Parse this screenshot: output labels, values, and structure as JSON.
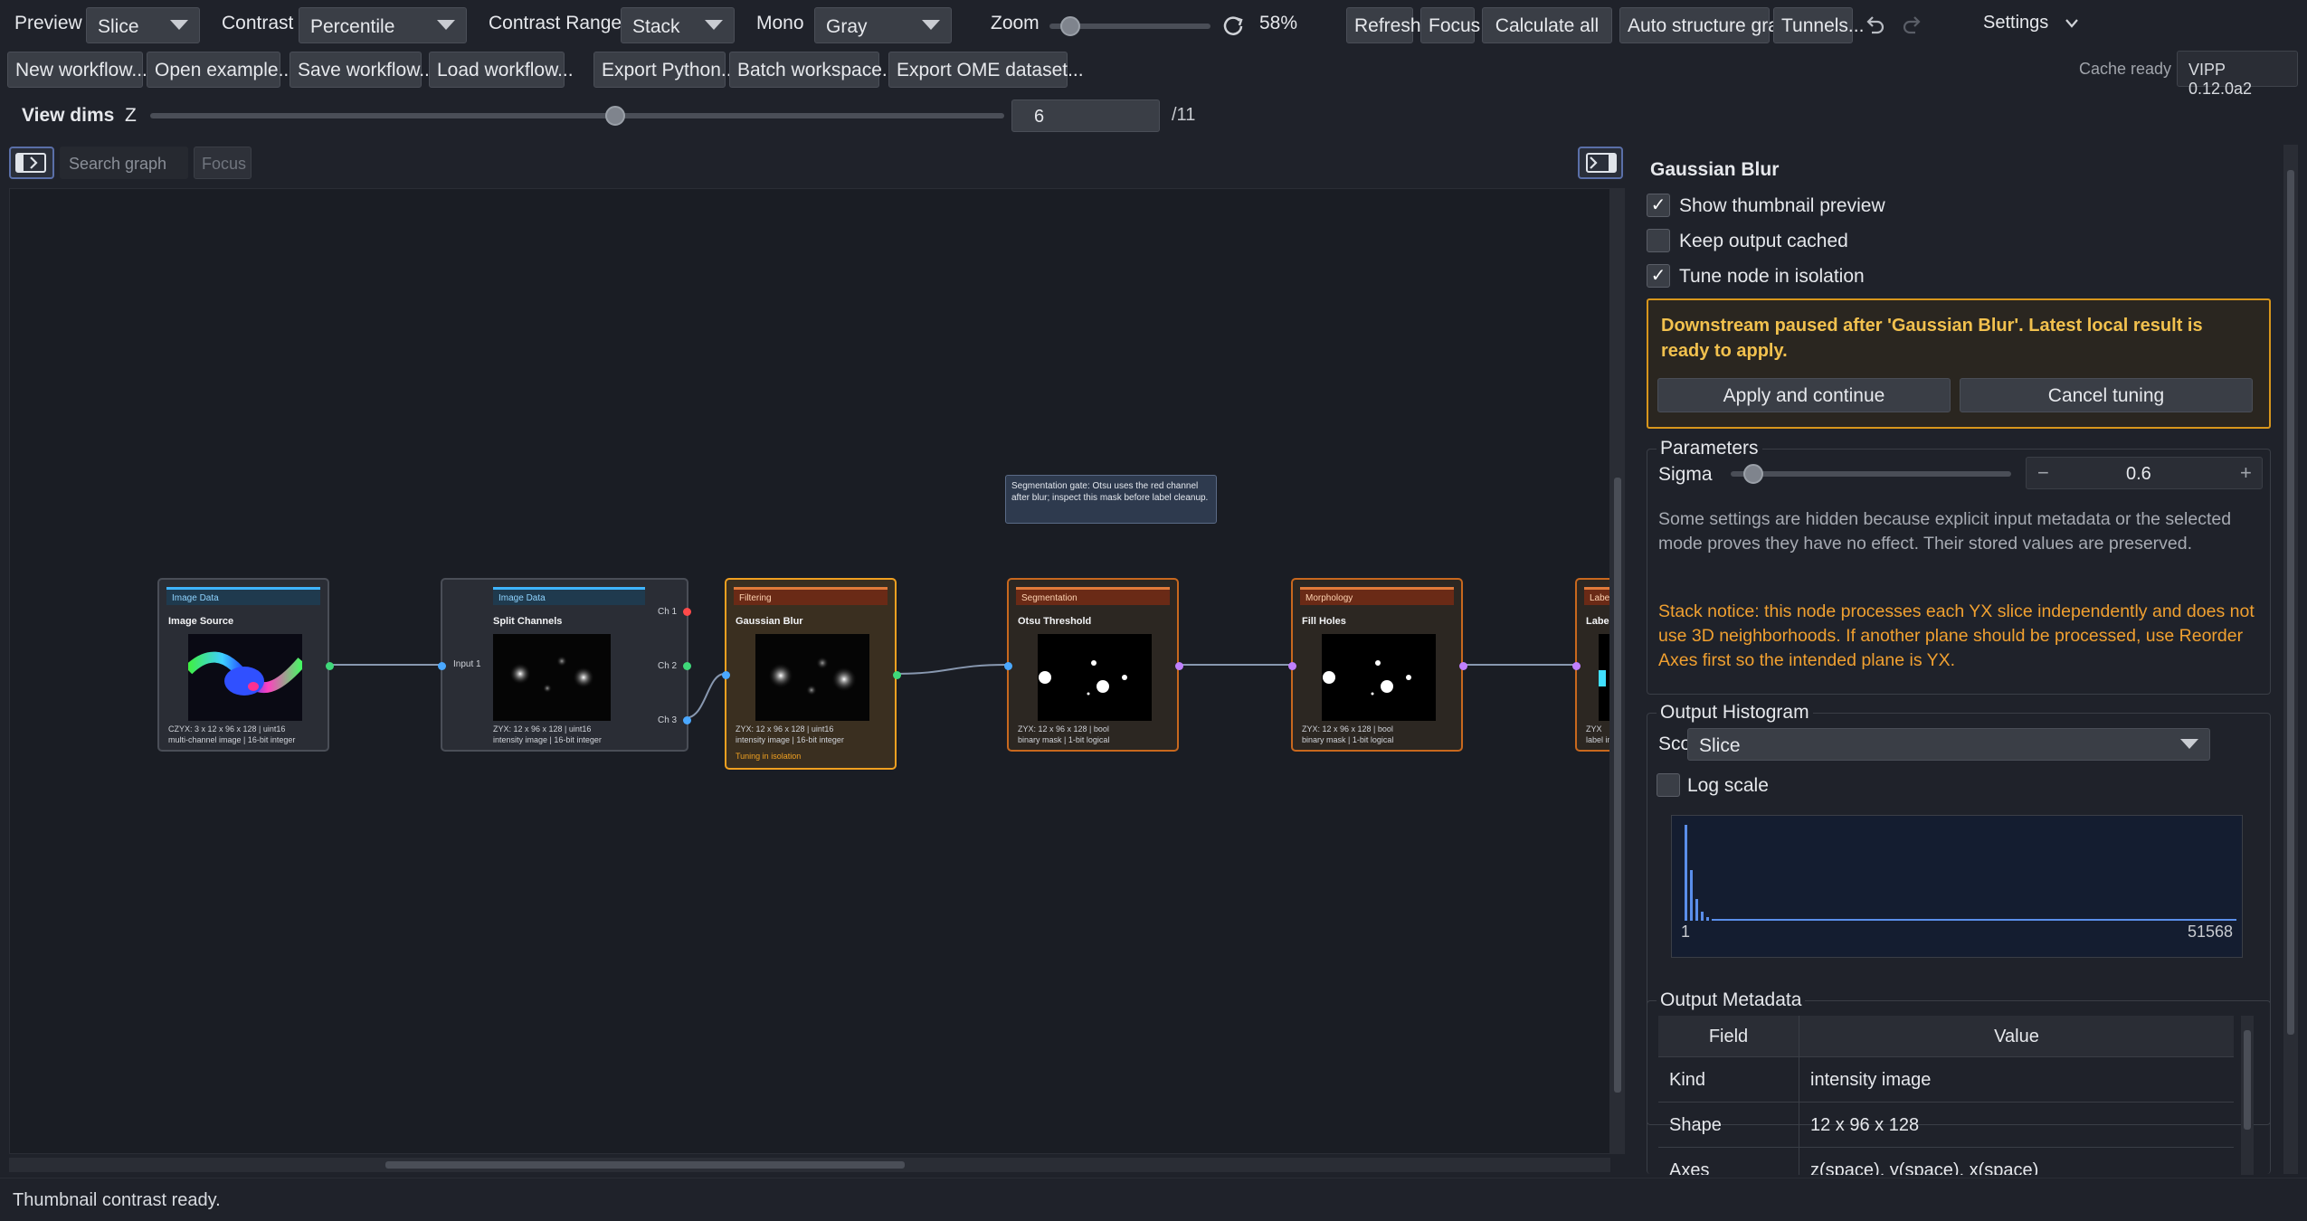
{
  "toolbar": {
    "preview_label": "Preview",
    "preview_value": "Slice",
    "contrast_label": "Contrast",
    "contrast_value": "Percentile",
    "contrast_range_label": "Contrast Range",
    "contrast_range_value": "Stack",
    "mono_label": "Mono",
    "mono_value": "Gray",
    "zoom_label": "Zoom",
    "zoom_value": "58%",
    "zoom_level": 0.07,
    "refresh": "Refresh",
    "focus": "Focus",
    "calculate_all": "Calculate all",
    "auto_structure": "Auto structure graph",
    "tunnels": "Tunnels...",
    "settings": "Settings"
  },
  "toolbar2": {
    "new_workflow": "New workflow...",
    "open_example": "Open example...",
    "save_workflow": "Save workflow...",
    "load_workflow": "Load workflow...",
    "export_python": "Export Python...",
    "batch_workspace": "Batch workspace...",
    "export_ome": "Export OME dataset...",
    "cache_status": "Cache ready",
    "version": "VIPP 0.12.0a2"
  },
  "view_dims": {
    "label": "View dims",
    "axis": "Z",
    "value": "6",
    "max": "/11",
    "position": 0.545
  },
  "graph": {
    "search_placeholder": "Search graph",
    "focus": "Focus",
    "tooltip": "Segmentation gate: Otsu uses the red channel after blur; inspect this mask before label cleanup.",
    "nodes": [
      {
        "category": "Image Data",
        "title": "Image Source",
        "meta1": "CZYX: 3 x 12 x 96 x 128 | uint16",
        "meta2": "multi-channel image | 16-bit integer"
      },
      {
        "category": "Image Data",
        "title": "Split Channels",
        "meta1": "ZYX: 12 x 96 x 128 | uint16",
        "meta2": "intensity image | 16-bit integer",
        "input": "Input 1",
        "outputs": [
          "Ch 1",
          "Ch 2",
          "Ch 3"
        ]
      },
      {
        "category": "Filtering",
        "title": "Gaussian Blur",
        "meta1": "ZYX: 12 x 96 x 128 | uint16",
        "meta2": "intensity image | 16-bit integer",
        "status": "Tuning in isolation"
      },
      {
        "category": "Segmentation",
        "title": "Otsu Threshold",
        "meta1": "ZYX: 12 x 96 x 128 | bool",
        "meta2": "binary mask | 1-bit logical"
      },
      {
        "category": "Morphology",
        "title": "Fill Holes",
        "meta1": "ZYX: 12 x 96 x 128 | bool",
        "meta2": "binary mask | 1-bit logical"
      },
      {
        "category": "Label",
        "title": "Label",
        "meta1": "ZYX",
        "meta2": "label im"
      }
    ]
  },
  "panel": {
    "title": "Gaussian Blur",
    "show_thumbnail": "Show thumbnail preview",
    "keep_cached": "Keep output cached",
    "tune_isolation": "Tune node in isolation",
    "notice": "Downstream paused after 'Gaussian Blur'. Latest local result is ready to apply.",
    "apply": "Apply and continue",
    "cancel": "Cancel tuning",
    "parameters_title": "Parameters",
    "sigma_label": "Sigma",
    "sigma_value": "0.6",
    "hidden_note": "Some settings are hidden because explicit input metadata or the selected mode proves they have no effect. Their stored values are preserved.",
    "stack_notice": "Stack notice: this node processes each YX slice independently and does not use 3D neighborhoods. If another plane should be processed, use Reorder Axes first so the intended plane is YX.",
    "histogram_title": "Output Histogram",
    "scope_label": "Scope",
    "scope_value": "Slice",
    "log_scale": "Log scale",
    "hist_min": "1",
    "hist_max": "51568",
    "metadata_title": "Output Metadata",
    "meta_headers": [
      "Field",
      "Value"
    ],
    "meta_rows": [
      [
        "Kind",
        "intensity image"
      ],
      [
        "Shape",
        "12 x 96 x 128"
      ],
      [
        "Axes",
        "z(space), y(space), x(space)"
      ]
    ]
  },
  "status_bar": "Thumbnail contrast ready.",
  "colors": {
    "accent_orange": "#f0a020",
    "notice_text": "#f2c14e",
    "stack_notice": "#f0a030"
  }
}
